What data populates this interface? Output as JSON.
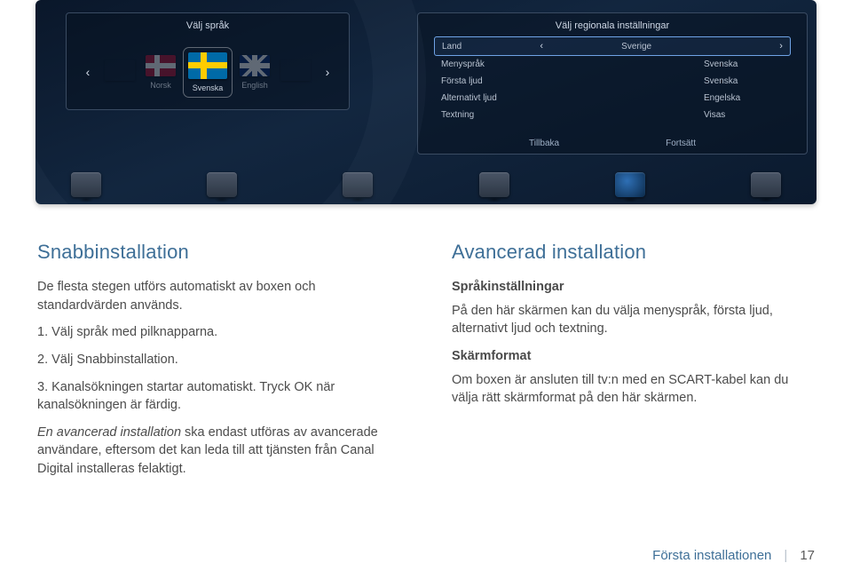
{
  "stb": {
    "lang_panel": {
      "title": "Välj språk",
      "items": [
        {
          "label": "",
          "dim": true
        },
        {
          "label": "Norsk",
          "dim": true,
          "flag": "no"
        },
        {
          "label": "Svenska",
          "flag": "se",
          "selected": true
        },
        {
          "label": "English",
          "dim": true,
          "flag": "gb"
        },
        {
          "label": "",
          "dim": true
        }
      ]
    },
    "region_panel": {
      "title": "Välj regionala inställningar",
      "rows": [
        {
          "key": "Land",
          "val": "Sverige",
          "selected": true,
          "chevrons": true
        },
        {
          "key": "Menyspråk",
          "val": "Svenska"
        },
        {
          "key": "Första ljud",
          "val": "Svenska"
        },
        {
          "key": "Alternativt ljud",
          "val": "Engelska"
        },
        {
          "key": "Textning",
          "val": "Visas"
        }
      ],
      "footer": {
        "back": "Tillbaka",
        "next": "Fortsätt"
      }
    }
  },
  "left": {
    "heading": "Snabbinstallation",
    "p1": "De flesta stegen utförs automatiskt av boxen och standardvärden används.",
    "li1": "1. Välj språk med pilknapparna.",
    "li2": "2. Välj Snabbinstallation.",
    "li3": "3. Kanalsökningen startar automatiskt. Tryck OK när kanalsökningen är färdig.",
    "p2a": "En avancerad installation",
    "p2b": " ska endast utföras av avancerade användare, eftersom det kan leda till att tjänsten från Canal Digital installeras felaktigt."
  },
  "right": {
    "heading": "Avancerad installation",
    "sub1": "Språkinställningar",
    "p1": "På den här skärmen kan du välja menyspråk, första ljud, alternativt ljud och textning.",
    "sub2": "Skärmformat",
    "p2": "Om boxen är ansluten till tv:n med en SCART-kabel kan du välja rätt skärmformat på den här skärmen."
  },
  "footer": {
    "section": "Första installationen",
    "page": "17"
  }
}
